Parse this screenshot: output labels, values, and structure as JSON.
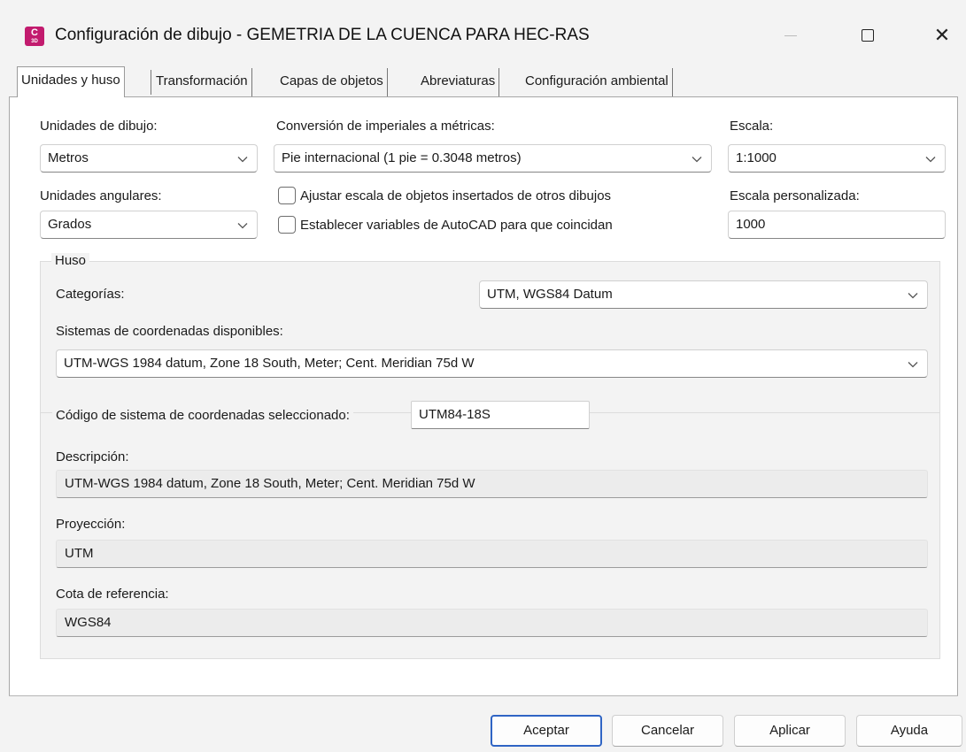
{
  "window": {
    "title": "Configuración de dibujo - GEMETRIA DE LA CUENCA PARA HEC-RAS",
    "icon_letter": "C",
    "icon_sub": "3D",
    "close_glyph": "✕"
  },
  "tabs": [
    {
      "label": "Unidades y huso",
      "active": true
    },
    {
      "label": "Transformación",
      "active": false
    },
    {
      "label": "Capas de objetos",
      "active": false
    },
    {
      "label": "Abreviaturas",
      "active": false
    },
    {
      "label": "Configuración ambiental",
      "active": false
    }
  ],
  "units": {
    "drawing_units_label": "Unidades de dibujo:",
    "drawing_units_value": "Metros",
    "conversion_label": "Conversión de imperiales a métricas:",
    "conversion_value": "Pie internacional (1 pie = 0.3048 metros)",
    "scale_label": "Escala:",
    "scale_value": "1:1000",
    "angular_units_label": "Unidades angulares:",
    "angular_units_value": "Grados",
    "checkbox_scale_label": "Ajustar escala de objetos insertados de otros dibujos",
    "checkbox_scale_checked": false,
    "checkbox_vars_label": "Establecer variables de AutoCAD para que coincidan",
    "checkbox_vars_checked": false,
    "custom_scale_label": "Escala personalizada:",
    "custom_scale_value": "1000"
  },
  "zone": {
    "group_title": "Huso",
    "categories_label": "Categorías:",
    "categories_value": "UTM, WGS84 Datum",
    "available_label": "Sistemas de coordenadas disponibles:",
    "available_value": "UTM-WGS 1984 datum, Zone 18 South, Meter; Cent. Meridian 75d W",
    "selected_code_label": "Código de sistema de coordenadas seleccionado:",
    "selected_code_value": "UTM84-18S",
    "description_label": "Descripción:",
    "description_value": "UTM-WGS 1984 datum, Zone 18 South, Meter; Cent. Meridian 75d W",
    "projection_label": "Proyección:",
    "projection_value": "UTM",
    "datum_label": "Cota de referencia:",
    "datum_value": "WGS84"
  },
  "buttons": {
    "ok": "Aceptar",
    "cancel": "Cancelar",
    "apply": "Aplicar",
    "help": "Ayuda"
  },
  "colors": {
    "app_icon": "#c21b6e",
    "primary_button_border": "#2f64c4"
  }
}
